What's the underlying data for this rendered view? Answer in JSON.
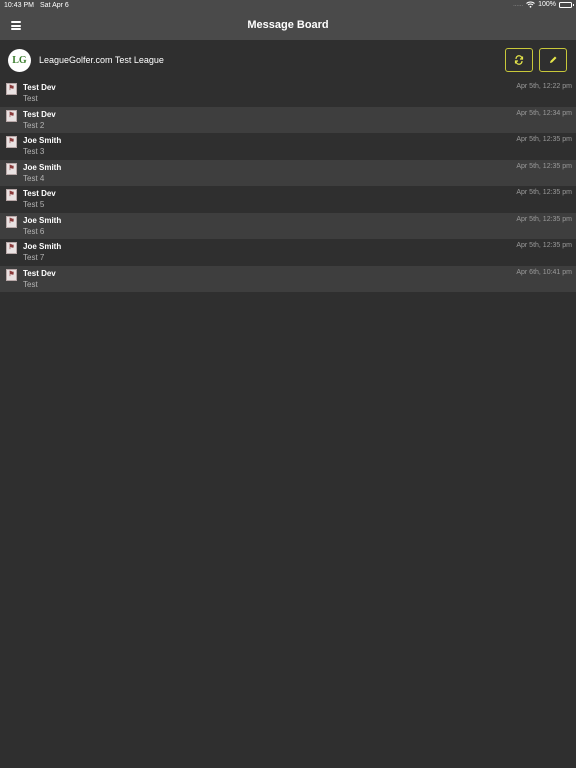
{
  "status_bar": {
    "time": "10:43 PM",
    "date": "Sat Apr 6",
    "signal": "......",
    "battery": "100%"
  },
  "nav": {
    "title": "Message Board"
  },
  "league": {
    "logo_text": "LG",
    "name": "LeagueGolfer.com Test League"
  },
  "colors": {
    "accent": "#c8c83a",
    "background": "#2f2f2f",
    "bar": "#4a4a4a"
  },
  "messages": [
    {
      "author": "Test Dev",
      "body": "Test",
      "time": "Apr 5th, 12:22 pm"
    },
    {
      "author": "Test Dev",
      "body": "Test 2",
      "time": "Apr 5th, 12:34 pm"
    },
    {
      "author": "Joe Smith",
      "body": "Test 3",
      "time": "Apr 5th, 12:35 pm"
    },
    {
      "author": "Joe Smith",
      "body": "Test 4",
      "time": "Apr 5th, 12:35 pm"
    },
    {
      "author": "Test Dev",
      "body": "Test 5",
      "time": "Apr 5th, 12:35 pm"
    },
    {
      "author": "Joe Smith",
      "body": "Test 6",
      "time": "Apr 5th, 12:35 pm"
    },
    {
      "author": "Joe Smith",
      "body": "Test 7",
      "time": "Apr 5th, 12:35 pm"
    },
    {
      "author": "Test Dev",
      "body": "Test",
      "time": "Apr 6th, 10:41 pm"
    }
  ]
}
